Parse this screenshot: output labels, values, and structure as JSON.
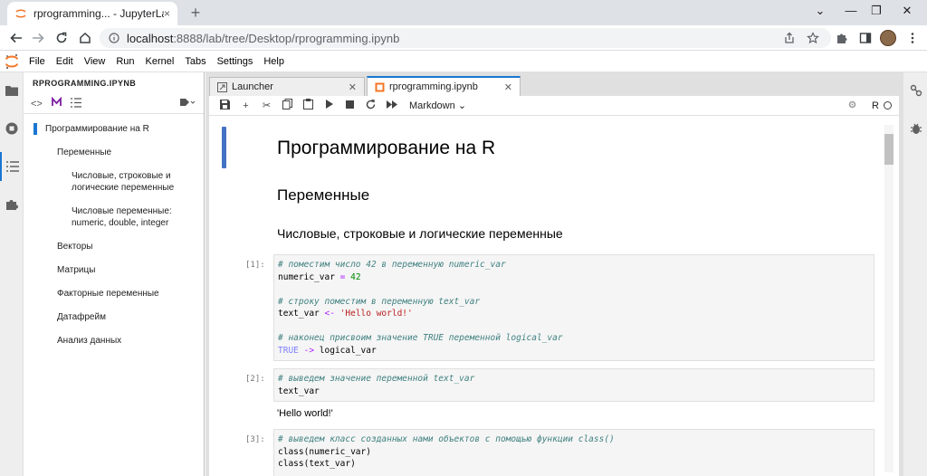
{
  "browser": {
    "tab_title": "rprogramming... - JupyterLab",
    "tab_close": "×",
    "new_tab": "+",
    "window_controls": [
      "⌄",
      "—",
      "❐",
      "✕"
    ],
    "url_host": "localhost",
    "url_rest": ":8888/lab/tree/Desktop/rprogramming.ipynb"
  },
  "menu": [
    "File",
    "Edit",
    "View",
    "Run",
    "Kernel",
    "Tabs",
    "Settings",
    "Help"
  ],
  "toc": {
    "header": "RPROGRAMMING.IPYNB",
    "items": [
      {
        "level": 1,
        "text": "Программирование на R"
      },
      {
        "level": 2,
        "text": "Переменные"
      },
      {
        "level": 3,
        "text": "Числовые, строковые и логические переменные"
      },
      {
        "level": 3,
        "text": "Числовые переменные: numeric, double, integer"
      },
      {
        "level": 2,
        "text": "Векторы"
      },
      {
        "level": 2,
        "text": "Матрицы"
      },
      {
        "level": 2,
        "text": "Факторные переменные"
      },
      {
        "level": 2,
        "text": "Датафрейм"
      },
      {
        "level": 2,
        "text": "Анализ данных"
      }
    ]
  },
  "tabs": [
    {
      "label": "Launcher",
      "active": false
    },
    {
      "label": "rprogramming.ipynb",
      "active": true
    }
  ],
  "notebook": {
    "cell_type": "Markdown",
    "kernel": "R",
    "h1": "Программирование на R",
    "h2": "Переменные",
    "h3": "Числовые, строковые и логические переменные",
    "cells": [
      {
        "prompt": "[1]:",
        "lines": [
          [
            {
              "t": "# поместим число 42 в переменную numeric_var",
              "c": "cm"
            }
          ],
          [
            {
              "t": "numeric_var ",
              "c": ""
            },
            {
              "t": "=",
              "c": "op"
            },
            {
              "t": " ",
              "c": ""
            },
            {
              "t": "42",
              "c": "num"
            }
          ],
          [],
          [
            {
              "t": "# строку поместим в переменную text_var",
              "c": "cm"
            }
          ],
          [
            {
              "t": "text_var ",
              "c": ""
            },
            {
              "t": "<-",
              "c": "op"
            },
            {
              "t": " ",
              "c": ""
            },
            {
              "t": "'Hello world!'",
              "c": "str"
            }
          ],
          [],
          [
            {
              "t": "# наконец присвоим значение TRUE переменной logical_var",
              "c": "cm"
            }
          ],
          [
            {
              "t": "TRUE",
              "c": "kw"
            },
            {
              "t": " ",
              "c": ""
            },
            {
              "t": "->",
              "c": "op"
            },
            {
              "t": " logical_var",
              "c": ""
            }
          ]
        ]
      },
      {
        "prompt": "[2]:",
        "lines": [
          [
            {
              "t": "# выведем значение переменной text_var",
              "c": "cm"
            }
          ],
          [
            {
              "t": "text_var",
              "c": ""
            }
          ]
        ],
        "output": "'Hello world!'"
      },
      {
        "prompt": "[3]:",
        "lines": [
          [
            {
              "t": "# выведем класс созданных нами объектов с помощью функции class()",
              "c": "cm"
            }
          ],
          [
            {
              "t": "class(numeric_var)",
              "c": ""
            }
          ],
          [
            {
              "t": "class(text_var)",
              "c": ""
            }
          ]
        ]
      }
    ]
  }
}
